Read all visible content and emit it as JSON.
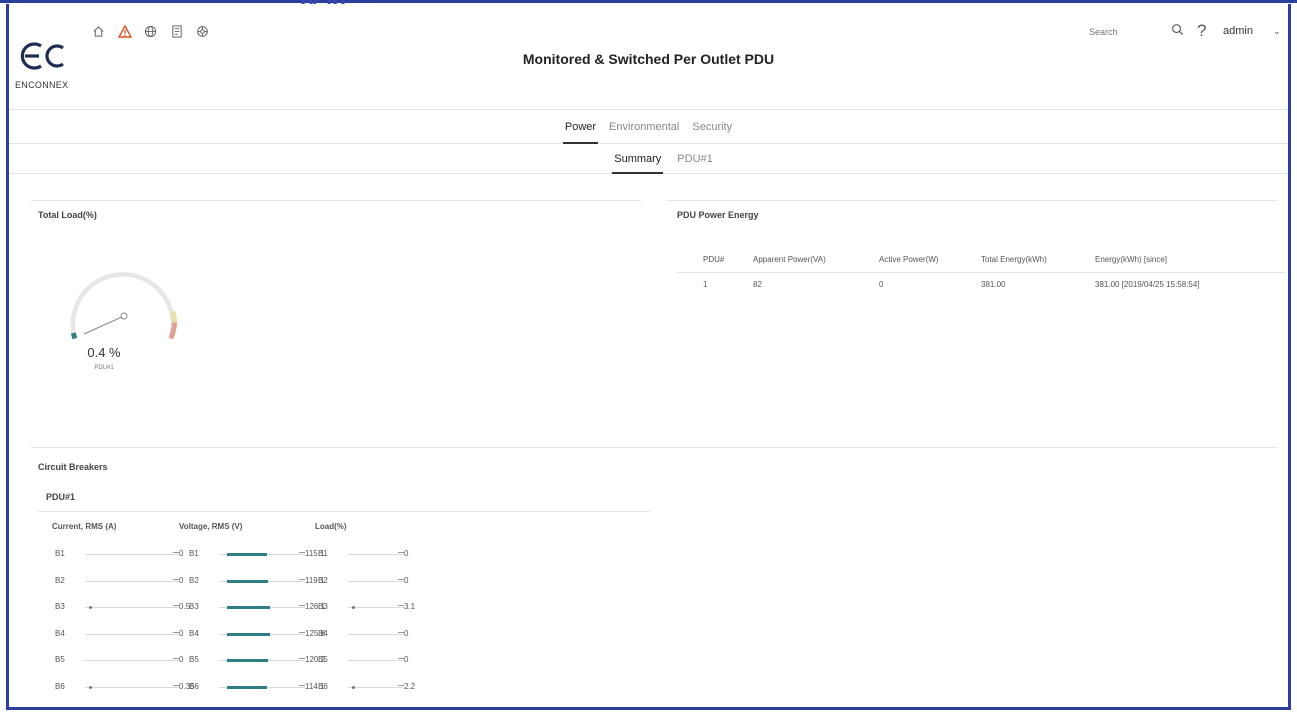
{
  "app": {
    "page_title": "Monitored & Switched Per Outlet PDU",
    "brand_name": "ENCONNEX",
    "frame_title_fragment": "ly ig"
  },
  "header": {
    "icons": [
      "home-icon",
      "alert-icon",
      "globe-icon",
      "document-icon",
      "settings-icon"
    ],
    "search_placeholder": "Search",
    "user": "admin"
  },
  "tabs": [
    {
      "label": "Power",
      "active": true
    },
    {
      "label": "Environmental",
      "active": false
    },
    {
      "label": "Security",
      "active": false
    }
  ],
  "subtabs": [
    {
      "label": "Summary",
      "active": true
    },
    {
      "label": "PDU#1",
      "active": false
    }
  ],
  "total_load": {
    "title": "Total Load(%)",
    "value_text": "0.4 %",
    "value": 0.4,
    "label": "PDU#1"
  },
  "energy": {
    "title": "PDU Power Energy",
    "columns": [
      "PDU#",
      "Apparent Power(VA)",
      "Active Power(W)",
      "Total Energy(kWh)",
      "Energy(kWh) [since]"
    ],
    "rows": [
      [
        "1",
        "82",
        "0",
        "381.00",
        "381.00 [2019/04/25 15:58:54]"
      ]
    ]
  },
  "breakers": {
    "title": "Circuit Breakers",
    "pdu_label": "PDU#1",
    "current": {
      "header": "Current, RMS (A)",
      "rows": [
        {
          "label": "B1",
          "value": "0",
          "fraction": 0
        },
        {
          "label": "B2",
          "value": "0",
          "fraction": 0
        },
        {
          "label": "B3",
          "value": "0.5",
          "fraction": 0.03
        },
        {
          "label": "B4",
          "value": "0",
          "fraction": 0
        },
        {
          "label": "B5",
          "value": "0",
          "fraction": 0
        },
        {
          "label": "B6",
          "value": "0.35",
          "fraction": 0.02
        }
      ]
    },
    "voltage": {
      "header": "Voltage, RMS (V)",
      "rows": [
        {
          "label": "B1",
          "value": "115.1",
          "fraction": 0.46
        },
        {
          "label": "B2",
          "value": "119.1",
          "fraction": 0.48
        },
        {
          "label": "B3",
          "value": "126.1",
          "fraction": 0.5
        },
        {
          "label": "B4",
          "value": "125.8",
          "fraction": 0.5
        },
        {
          "label": "B5",
          "value": "120.2",
          "fraction": 0.48
        },
        {
          "label": "B6",
          "value": "114.1",
          "fraction": 0.46
        }
      ]
    },
    "load": {
      "header": "Load(%)",
      "rows": [
        {
          "label": "B1",
          "value": "0",
          "fraction": 0
        },
        {
          "label": "B2",
          "value": "0",
          "fraction": 0
        },
        {
          "label": "B3",
          "value": "3.1",
          "fraction": 0.03
        },
        {
          "label": "B4",
          "value": "0",
          "fraction": 0
        },
        {
          "label": "B5",
          "value": "0",
          "fraction": 0
        },
        {
          "label": "B6",
          "value": "2.2",
          "fraction": 0.02
        }
      ]
    }
  },
  "colors": {
    "frame": "#2b3f9c",
    "bar_fill": "#2f7e86",
    "gauge_low": "#2f7e86",
    "gauge_warn": "#e8e0a8",
    "gauge_high": "#e0a090"
  }
}
